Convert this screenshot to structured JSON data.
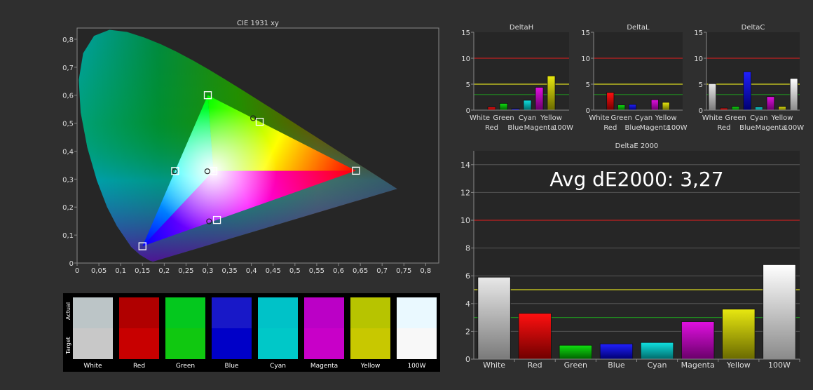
{
  "colors": {
    "page_bg": "#2f2f2f",
    "plot_bg": "#262626",
    "axis": "#888888",
    "text": "#dddddd",
    "red_line": "#c02020",
    "yellow_line": "#d8d820",
    "green_line": "#208a20"
  },
  "chart_data": [
    {
      "id": "cie",
      "type": "scatter",
      "title": "CIE 1931 xy",
      "xlabel": "",
      "ylabel": "",
      "xlim": [
        0,
        0.83
      ],
      "ylim": [
        0,
        0.84
      ],
      "x_ticks": [
        "0",
        "0,05",
        "0,1",
        "0,15",
        "0,2",
        "0,25",
        "0,3",
        "0,35",
        "0,4",
        "0,45",
        "0,5",
        "0,55",
        "0,6",
        "0,65",
        "0,7",
        "0,75",
        "0,8"
      ],
      "y_ticks": [
        "0",
        "0,1",
        "0,2",
        "0,3",
        "0,4",
        "0,5",
        "0,6",
        "0,7",
        "0,8"
      ],
      "targets": [
        {
          "name": "Red",
          "x": 0.64,
          "y": 0.33
        },
        {
          "name": "Green",
          "x": 0.3,
          "y": 0.6
        },
        {
          "name": "Blue",
          "x": 0.15,
          "y": 0.06
        },
        {
          "name": "Cyan",
          "x": 0.225,
          "y": 0.329
        },
        {
          "name": "Magenta",
          "x": 0.321,
          "y": 0.154
        },
        {
          "name": "Yellow",
          "x": 0.419,
          "y": 0.505
        },
        {
          "name": "White",
          "x": 0.3127,
          "y": 0.329
        }
      ],
      "measured": [
        {
          "name": "Cyan",
          "x": 0.224,
          "y": 0.328
        },
        {
          "name": "Magenta",
          "x": 0.303,
          "y": 0.149
        },
        {
          "name": "Yellow",
          "x": 0.404,
          "y": 0.518
        },
        {
          "name": "White",
          "x": 0.299,
          "y": 0.328
        }
      ]
    },
    {
      "id": "deltaH",
      "type": "bar",
      "title": "DeltaH",
      "categories": [
        "White",
        "Red",
        "Green",
        "Blue",
        "Cyan",
        "Magenta",
        "Yellow",
        "100W"
      ],
      "values": [
        0,
        0.6,
        1.3,
        0.3,
        1.9,
        4.4,
        6.6,
        0
      ],
      "ylim": [
        0,
        15
      ],
      "y_ticks": [
        "0",
        "5",
        "10",
        "15"
      ],
      "thresholds": [
        10,
        5,
        3
      ]
    },
    {
      "id": "deltaL",
      "type": "bar",
      "title": "DeltaL",
      "categories": [
        "White",
        "Red",
        "Green",
        "Blue",
        "Cyan",
        "Magenta",
        "Yellow",
        "100W"
      ],
      "values": [
        0,
        3.4,
        1.0,
        1.1,
        0,
        2.0,
        1.5,
        0
      ],
      "ylim": [
        0,
        15
      ],
      "y_ticks": [
        "0",
        "5",
        "10",
        "15"
      ],
      "thresholds": [
        10,
        5,
        3
      ]
    },
    {
      "id": "deltaC",
      "type": "bar",
      "title": "DeltaC",
      "categories": [
        "White",
        "Red",
        "Green",
        "Blue",
        "Cyan",
        "Magenta",
        "Yellow",
        "100W"
      ],
      "values": [
        5.1,
        0.4,
        0.7,
        7.4,
        0.6,
        2.6,
        0.7,
        6.1
      ],
      "ylim": [
        0,
        15
      ],
      "y_ticks": [
        "0",
        "5",
        "10",
        "15"
      ],
      "thresholds": [
        10,
        5,
        3
      ]
    },
    {
      "id": "deltaE",
      "type": "bar",
      "title": "DeltaE 2000",
      "annotation": "Avg dE2000: 3,27",
      "categories": [
        "White",
        "Red",
        "Green",
        "Blue",
        "Cyan",
        "Magenta",
        "Yellow",
        "100W"
      ],
      "values": [
        5.9,
        3.3,
        1.0,
        1.1,
        1.2,
        2.7,
        3.6,
        6.8
      ],
      "ylim": [
        0,
        15
      ],
      "y_ticks": [
        "0",
        "2",
        "4",
        "6",
        "8",
        "10",
        "12",
        "14"
      ],
      "thresholds": [
        10,
        5,
        3
      ]
    }
  ],
  "swatches": {
    "row_labels": {
      "actual": "Actual",
      "target": "Target"
    },
    "items": [
      {
        "label": "White",
        "actual": "#bcc5c7",
        "target": "#c8c8c8"
      },
      {
        "label": "Red",
        "actual": "#b00000",
        "target": "#c80000"
      },
      {
        "label": "Green",
        "actual": "#04c81e",
        "target": "#10c810"
      },
      {
        "label": "Blue",
        "actual": "#1818c8",
        "target": "#0000c8"
      },
      {
        "label": "Cyan",
        "actual": "#00c2c8",
        "target": "#00c8c8"
      },
      {
        "label": "Magenta",
        "actual": "#bb00c6",
        "target": "#c800c8"
      },
      {
        "label": "Yellow",
        "actual": "#b7c400",
        "target": "#c8c800"
      },
      {
        "label": "100W",
        "actual": "#eaf9ff",
        "target": "#f8f8f8"
      }
    ]
  },
  "bar_colors": {
    "White": [
      "#e8e8e8",
      "#7a7a7a"
    ],
    "Red": [
      "#ff1010",
      "#700000"
    ],
    "Green": [
      "#10e010",
      "#006000"
    ],
    "Blue": [
      "#2020ff",
      "#000070"
    ],
    "Cyan": [
      "#10e0e0",
      "#006a6a"
    ],
    "Magenta": [
      "#e010e0",
      "#6a006a"
    ],
    "Yellow": [
      "#e8e810",
      "#6a6a00"
    ],
    "100W": [
      "#ffffff",
      "#8a8a8a"
    ]
  }
}
